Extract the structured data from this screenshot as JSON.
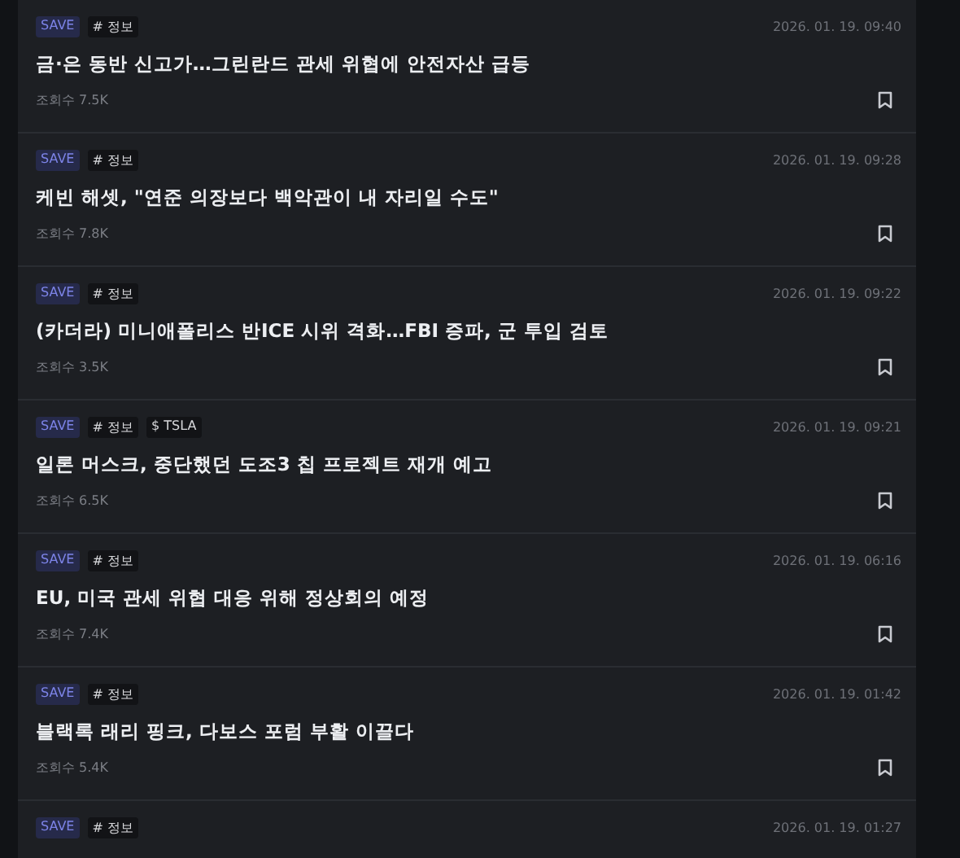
{
  "posts": [
    {
      "badge": "SAVE",
      "tags": [
        "# 정보"
      ],
      "date": "2026. 01. 19. 09:40",
      "title": "금·은 동반 신고가…그린란드 관세 위협에 안전자산 급등",
      "views": "조회수 7.5K"
    },
    {
      "badge": "SAVE",
      "tags": [
        "# 정보"
      ],
      "date": "2026. 01. 19. 09:28",
      "title": "케빈 해셋, \"연준 의장보다 백악관이 내 자리일 수도\"",
      "views": "조회수 7.8K"
    },
    {
      "badge": "SAVE",
      "tags": [
        "# 정보"
      ],
      "date": "2026. 01. 19. 09:22",
      "title": "(카더라) 미니애폴리스 반ICE 시위 격화…FBI 증파, 군 투입 검토",
      "views": "조회수 3.5K"
    },
    {
      "badge": "SAVE",
      "tags": [
        "# 정보",
        "$ TSLA"
      ],
      "date": "2026. 01. 19. 09:21",
      "title": "일론 머스크, 중단했던 도조3 칩 프로젝트 재개 예고",
      "views": "조회수 6.5K"
    },
    {
      "badge": "SAVE",
      "tags": [
        "# 정보"
      ],
      "date": "2026. 01. 19. 06:16",
      "title": "EU, 미국 관세 위협 대응 위해 정상회의 예정",
      "views": "조회수 7.4K"
    },
    {
      "badge": "SAVE",
      "tags": [
        "# 정보"
      ],
      "date": "2026. 01. 19. 01:42",
      "title": "블랙록 래리 핑크, 다보스 포럼 부활 이끌다",
      "views": "조회수 5.4K"
    },
    {
      "badge": "SAVE",
      "tags": [
        "# 정보"
      ],
      "date": "2026. 01. 19. 01:27"
    }
  ]
}
